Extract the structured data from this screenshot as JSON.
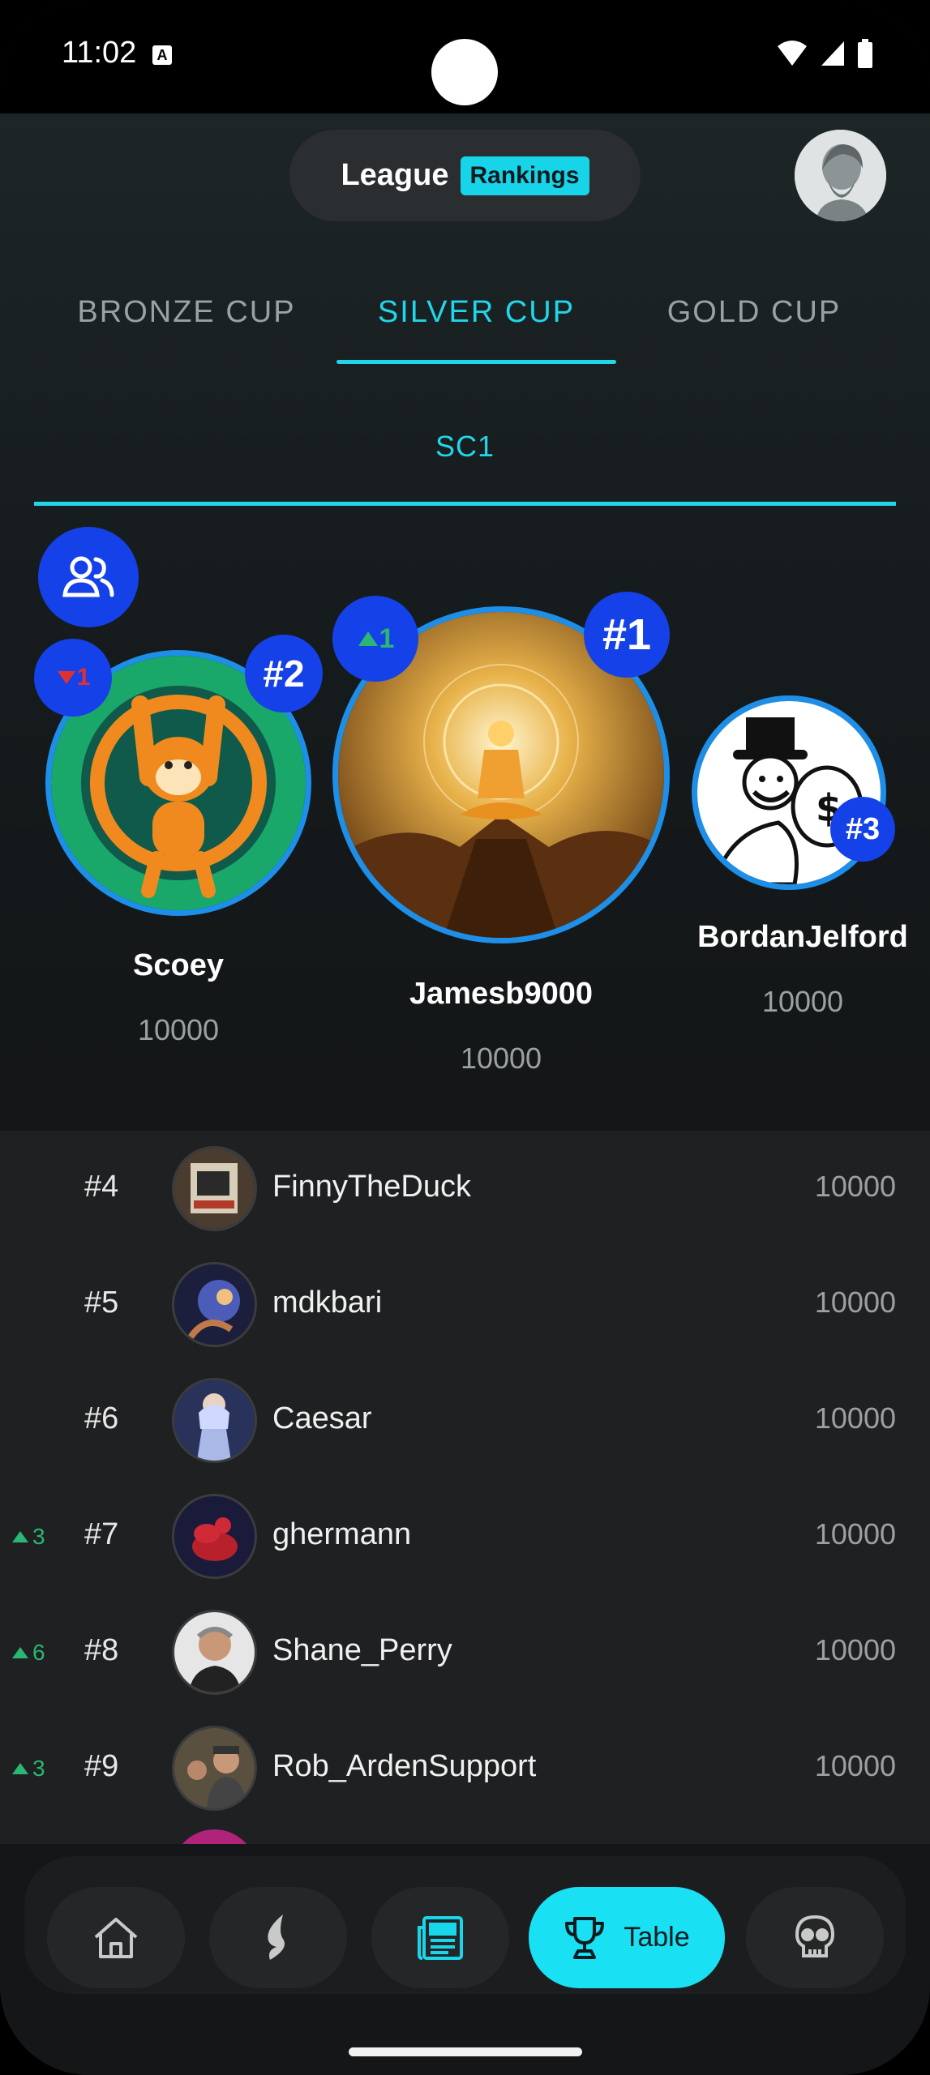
{
  "status_bar": {
    "time": "11:02",
    "notification_glyph": "A"
  },
  "header": {
    "title": "League",
    "badge": "Rankings"
  },
  "cup_tabs": [
    {
      "label": "BRONZE CUP",
      "active": false
    },
    {
      "label": "SILVER CUP",
      "active": true
    },
    {
      "label": "GOLD CUP",
      "active": false
    }
  ],
  "league_tab": {
    "label": "SC1"
  },
  "podium": {
    "first": {
      "rank": "#1",
      "name": "Jamesb9000",
      "score": "10000",
      "movement": "1",
      "movement_dir": "up"
    },
    "second": {
      "rank": "#2",
      "name": "Scoey",
      "score": "10000",
      "movement": "1",
      "movement_dir": "down"
    },
    "third": {
      "rank": "#3",
      "name": "BordanJelford",
      "score": "10000"
    }
  },
  "rankings": [
    {
      "rank": "#4",
      "name": "FinnyTheDuck",
      "score": "10000",
      "movement": ""
    },
    {
      "rank": "#5",
      "name": "mdkbari",
      "score": "10000",
      "movement": ""
    },
    {
      "rank": "#6",
      "name": "Caesar",
      "score": "10000",
      "movement": ""
    },
    {
      "rank": "#7",
      "name": "ghermann",
      "score": "10000",
      "movement": "3"
    },
    {
      "rank": "#8",
      "name": "Shane_Perry",
      "score": "10000",
      "movement": "6"
    },
    {
      "rank": "#9",
      "name": "Rob_ArdenSupport",
      "score": "10000",
      "movement": "3"
    }
  ],
  "bottom_nav": {
    "items": [
      {
        "icon": "home-icon",
        "active": false
      },
      {
        "icon": "flame-icon",
        "active": false
      },
      {
        "icon": "news-icon",
        "active": false
      },
      {
        "icon": "trophy-icon",
        "active": true,
        "label": "Table"
      },
      {
        "icon": "skull-icon",
        "active": false
      }
    ]
  },
  "colors": {
    "accent": "#20d6ea",
    "badge_blue": "#1541e8",
    "up_green": "#2bb673",
    "down_red": "#e03131"
  }
}
